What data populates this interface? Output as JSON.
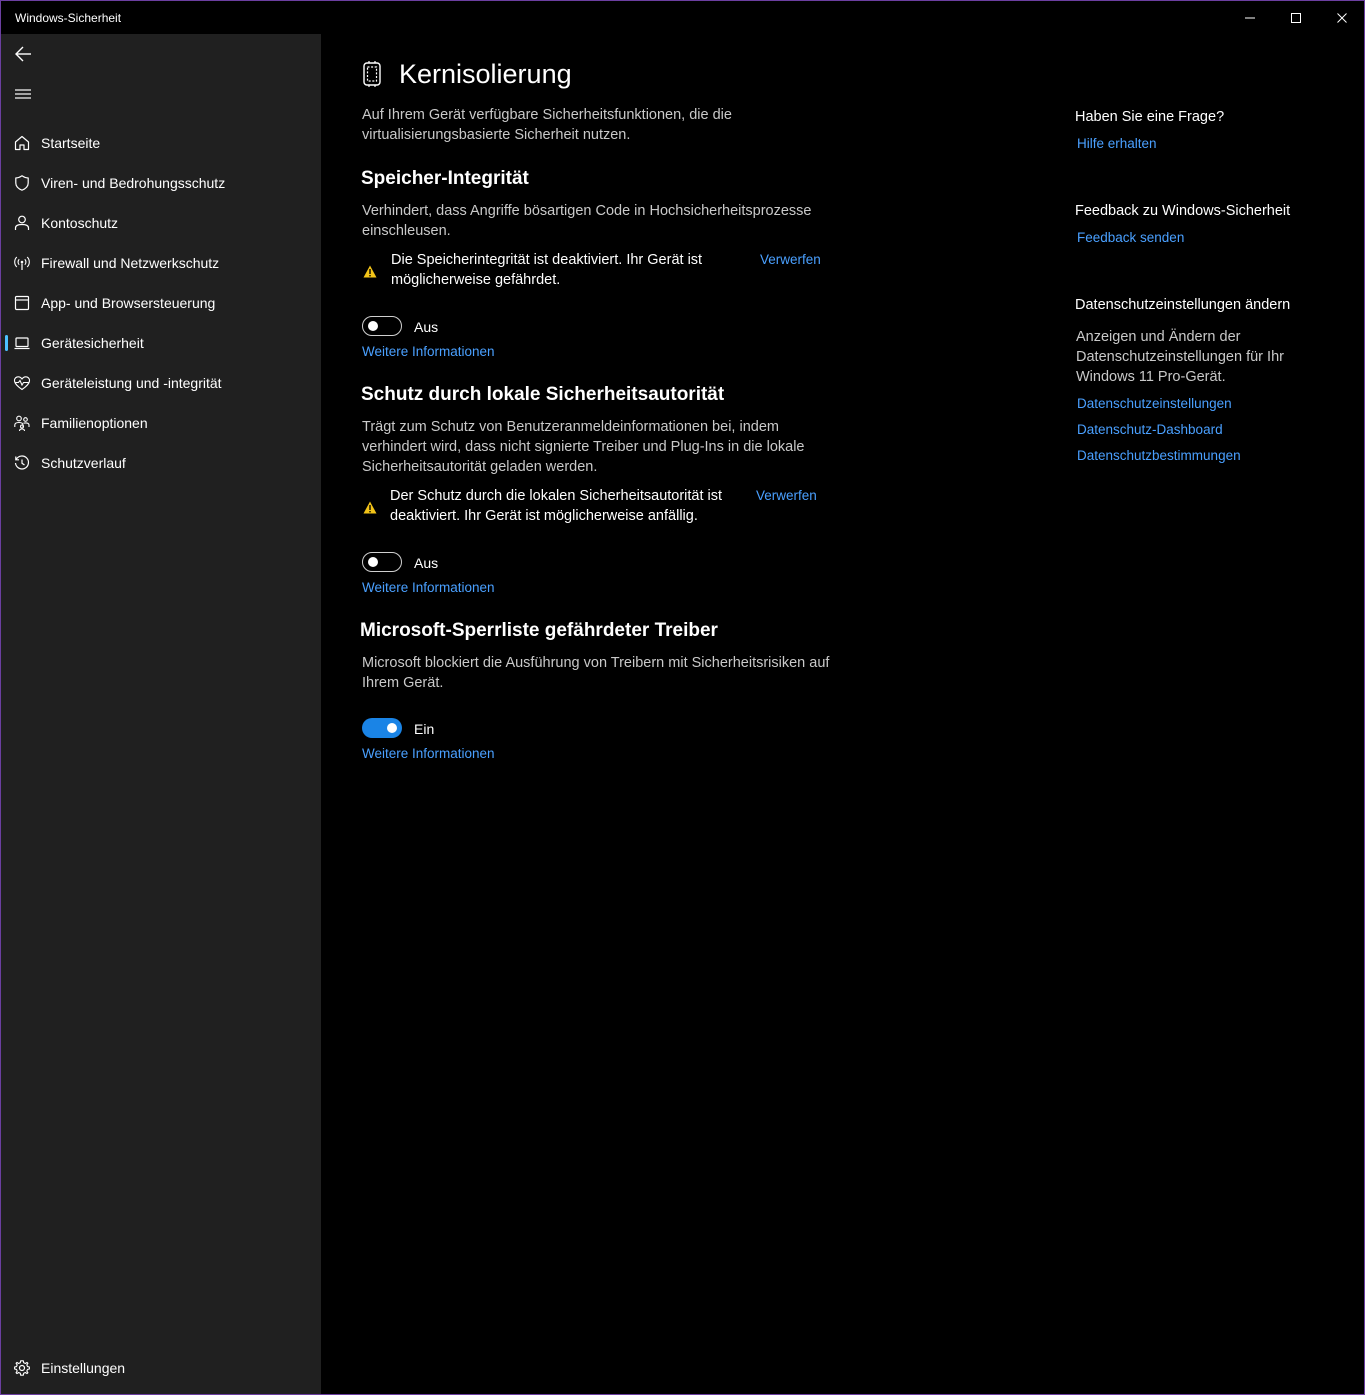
{
  "window": {
    "title": "Windows-Sicherheit"
  },
  "sidebar": {
    "items": [
      {
        "label": "Startseite",
        "icon": "home-icon"
      },
      {
        "label": "Viren- und Bedrohungsschutz",
        "icon": "shield-icon"
      },
      {
        "label": "Kontoschutz",
        "icon": "person-icon"
      },
      {
        "label": "Firewall und Netzwerkschutz",
        "icon": "antenna-icon"
      },
      {
        "label": "App- und Browsersteuerung",
        "icon": "browser-window-icon"
      },
      {
        "label": "Gerätesicherheit",
        "icon": "laptop-icon",
        "selected": true
      },
      {
        "label": "Geräteleistung und -integrität",
        "icon": "heart-pulse-icon"
      },
      {
        "label": "Familienoptionen",
        "icon": "family-icon"
      },
      {
        "label": "Schutzverlauf",
        "icon": "history-icon"
      }
    ],
    "settings_label": "Einstellungen"
  },
  "main": {
    "title": "Kernisolierung",
    "intro_line1": "Auf Ihrem Gerät verfügbare Sicherheitsfunktionen, die die",
    "intro_line2": "virtualisierungsbasierte Sicherheit nutzen.",
    "sections": [
      {
        "title": "Speicher-Integrität",
        "desc_lines": [
          "Verhindert, dass Angriffe bösartigen Code in Hochsicherheitsprozesse",
          "einschleusen."
        ],
        "warning_lines": [
          "Die Speicherintegrität ist deaktiviert. Ihr Gerät ist",
          "möglicherweise gefährdet."
        ],
        "dismiss": "Verwerfen",
        "toggle_on": false,
        "toggle_label": "Aus",
        "more_info": "Weitere Informationen"
      },
      {
        "title": "Schutz durch lokale Sicherheitsautorität",
        "desc_lines": [
          "Trägt zum Schutz von Benutzeranmeldeinformationen bei, indem",
          "verhindert wird, dass nicht signierte Treiber und Plug-Ins in die lokale",
          "Sicherheitsautorität geladen werden."
        ],
        "warning_lines": [
          "Der Schutz durch die lokalen Sicherheitsautorität ist",
          "deaktiviert. Ihr Gerät ist möglicherweise anfällig."
        ],
        "dismiss": "Verwerfen",
        "toggle_on": false,
        "toggle_label": "Aus",
        "more_info": "Weitere Informationen"
      },
      {
        "title": "Microsoft-Sperrliste gefährdeter Treiber",
        "desc_lines": [
          "Microsoft blockiert die Ausführung von Treibern mit Sicherheitsrisiken auf",
          "Ihrem Gerät."
        ],
        "toggle_on": true,
        "toggle_label": "Ein",
        "more_info": "Weitere Informationen"
      }
    ]
  },
  "side_panel": {
    "question_heading": "Haben Sie eine Frage?",
    "help_link": "Hilfe erhalten",
    "feedback_heading": "Feedback zu Windows-Sicherheit",
    "feedback_link": "Feedback senden",
    "privacy_heading": "Datenschutzeinstellungen ändern",
    "privacy_text_lines": [
      "Anzeigen und Ändern der",
      "Datenschutzeinstellungen für Ihr",
      "Windows 11 Pro-Gerät."
    ],
    "privacy_links": [
      "Datenschutzeinstellungen",
      "Datenschutz-Dashboard",
      "Datenschutzbestimmungen"
    ]
  },
  "colors": {
    "accent": "#4aa0ff",
    "toggle_on": "#1a84e6",
    "warning": "#f2c318",
    "sidebar_bg": "#202020",
    "selection": "#4cc2ff"
  }
}
